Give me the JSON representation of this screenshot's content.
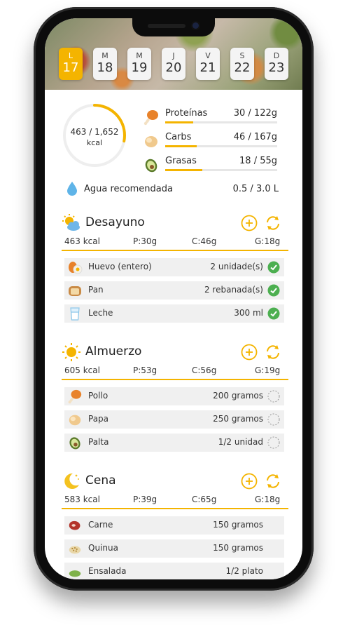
{
  "days": [
    {
      "letter": "L",
      "num": "17",
      "active": true
    },
    {
      "letter": "M",
      "num": "18",
      "active": false
    },
    {
      "letter": "M",
      "num": "19",
      "active": false
    },
    {
      "letter": "J",
      "num": "20",
      "active": false
    },
    {
      "letter": "V",
      "num": "21",
      "active": false
    },
    {
      "letter": "S",
      "num": "22",
      "active": false
    },
    {
      "letter": "D",
      "num": "23",
      "active": false
    }
  ],
  "summary": {
    "kcal_value": "463 / 1,652",
    "kcal_unit": "kcal",
    "kcal_progress": 0.28
  },
  "macros": [
    {
      "name": "Proteínas",
      "value": "30 / 122g",
      "icon": "drumstick-icon",
      "progress": 0.25
    },
    {
      "name": "Carbs",
      "value": "46 / 167g",
      "icon": "potato-icon",
      "progress": 0.28
    },
    {
      "name": "Grasas",
      "value": "18 / 55g",
      "icon": "avocado-icon",
      "progress": 0.33
    }
  ],
  "water": {
    "label": "Agua recomendada",
    "value": "0.5 / 3.0 L",
    "icon": "water-drop-icon"
  },
  "meals": [
    {
      "title": "Desayuno",
      "icon": "partly-sunny-icon",
      "kcal": "463 kcal",
      "p": "P:30g",
      "c": "C:46g",
      "g": "G:18g",
      "items": [
        {
          "name": "Huevo (entero)",
          "qty": "2 unidade(s)",
          "done": true,
          "icon": "egg-icon"
        },
        {
          "name": "Pan",
          "qty": "2 rebanada(s)",
          "done": true,
          "icon": "bread-icon"
        },
        {
          "name": "Leche",
          "qty": "300 ml",
          "done": true,
          "icon": "milk-glass-icon"
        }
      ]
    },
    {
      "title": "Almuerzo",
      "icon": "sun-icon",
      "kcal": "605 kcal",
      "p": "P:53g",
      "c": "C:56g",
      "g": "G:19g",
      "items": [
        {
          "name": "Pollo",
          "qty": "200 gramos",
          "done": false,
          "icon": "drumstick-icon"
        },
        {
          "name": "Papa",
          "qty": "250 gramos",
          "done": false,
          "icon": "potato-icon"
        },
        {
          "name": "Palta",
          "qty": "1/2 unidad",
          "done": false,
          "icon": "avocado-icon"
        }
      ]
    },
    {
      "title": "Cena",
      "icon": "moon-icon",
      "kcal": "583 kcal",
      "p": "P:39g",
      "c": "C:65g",
      "g": "G:18g",
      "items": [
        {
          "name": "Carne",
          "qty": "150 gramos",
          "done": false,
          "icon": "steak-icon"
        },
        {
          "name": "Quinua",
          "qty": "150 gramos",
          "done": false,
          "icon": "quinoa-icon"
        },
        {
          "name": "Ensalada",
          "qty": "1/2 plato",
          "done": false,
          "icon": "salad-icon"
        }
      ]
    }
  ],
  "colors": {
    "accent": "#f4b400",
    "check": "#4caf50"
  }
}
